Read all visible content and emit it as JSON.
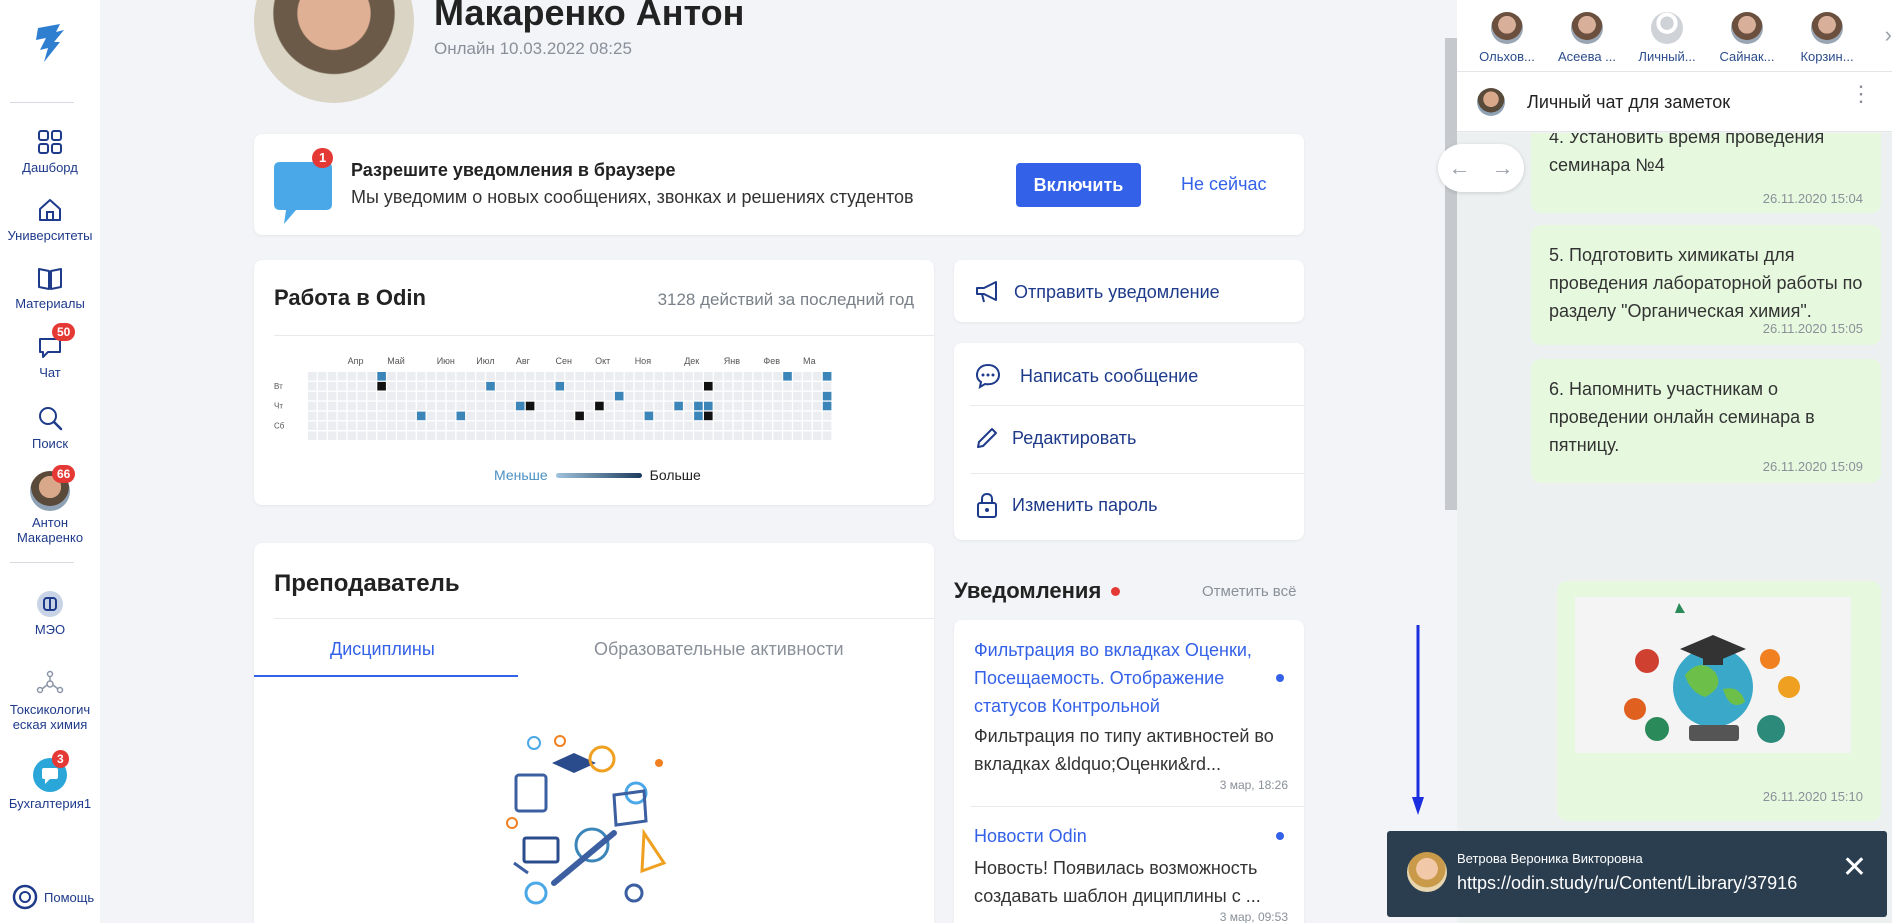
{
  "sidebar": {
    "items": [
      {
        "label": "Дашборд",
        "icon": "dashboard-icon"
      },
      {
        "label": "Университеты",
        "icon": "home-icon"
      },
      {
        "label": "Материалы",
        "icon": "book-icon"
      },
      {
        "label": "Чат",
        "icon": "chat-icon",
        "badge": "50"
      },
      {
        "label": "Поиск",
        "icon": "search-icon"
      },
      {
        "label": "Антон Макаренко",
        "icon": "avatar",
        "badge": "66"
      },
      {
        "label": "МЭО",
        "icon": "mao-icon"
      },
      {
        "label": "Токсикологич еская химия",
        "icon": "molecule-icon"
      },
      {
        "label": "Бухгалтерия1",
        "icon": "chat-group-icon",
        "badge": "3"
      }
    ],
    "help_label": "Помощь"
  },
  "profile": {
    "name": "Макаренко Антон",
    "status": "Онлайн 10.03.2022 08:25"
  },
  "notification_banner": {
    "badge": "1",
    "title": "Разрешите уведомления в браузере",
    "text": "Мы уведомим о новых сообщениях, звонках и решениях студентов",
    "enable_label": "Включить",
    "later_label": "Не сейчас"
  },
  "activity": {
    "title": "Работа в Odin",
    "count": "3128 действий за последний год",
    "months": [
      "Апр",
      "Май",
      "Июн",
      "Июл",
      "Авг",
      "Сен",
      "Окт",
      "Ноя",
      "Дек",
      "Янв",
      "Фев",
      "Ма"
    ],
    "days": [
      "Вт",
      "Чт",
      "Сб"
    ],
    "legend_less": "Меньше",
    "legend_more": "Больше",
    "colors": {
      "empty": "#ebedf0",
      "mid": "#3b85b9",
      "dark": "#111111"
    }
  },
  "actions": {
    "send_notification": "Отправить уведомление",
    "write_message": "Написать сообщение",
    "edit": "Редактировать",
    "change_password": "Изменить пароль"
  },
  "teacher": {
    "title": "Преподаватель",
    "tabs": [
      "Дисциплины",
      "Образовательные активности"
    ]
  },
  "notifications": {
    "heading": "Уведомления",
    "mark_all": "Отметить всё",
    "items": [
      {
        "title": "Фильтрация во вкладках Оценки, Посещаемость. Отображение статусов Контрольной",
        "text": "Фильтрация по типу активностей во вкладках &ldquo;Оценки&rd...",
        "time": "3 мар, 18:26"
      },
      {
        "title": "Новости Odin",
        "text": "Новость! Появилась возможность создавать шаблон дициплины с ...",
        "time": "3 мар, 09:53"
      }
    ]
  },
  "chat": {
    "contacts": [
      "Ольхов...",
      "Асеева ...",
      "Личный...",
      "Сайнак...",
      "Корзин..."
    ],
    "header_title": "Личный чат для заметок",
    "messages": [
      {
        "text": "4. Установить время проведения семинара №4",
        "time": "26.11.2020 15:04"
      },
      {
        "text": "5. Подготовить химикаты для проведения лабораторной работы по разделу \"Органическая химия\".",
        "time": "26.11.2020 15:05"
      },
      {
        "text": "6. Напомнить участникам о проведении онлайн семинара в пятницу.",
        "time": "26.11.2020 15:09"
      },
      {
        "text": "",
        "time": "26.11.2020 15:10"
      }
    ]
  },
  "toast": {
    "name": "Ветрова Вероника Викторовна",
    "link": "https://odin.study/ru/Content/Library/37916"
  }
}
